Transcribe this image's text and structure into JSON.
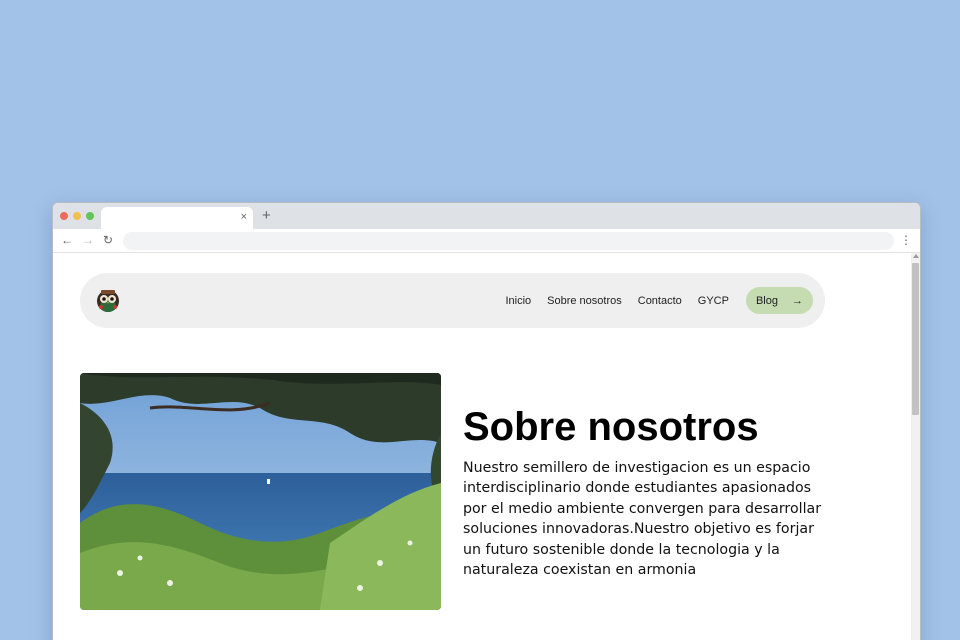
{
  "browser": {
    "tab_close": "×",
    "new_tab": "+",
    "back": "←",
    "forward": "→",
    "reload": "↻",
    "menu": "⋮"
  },
  "nav": {
    "links": [
      "Inicio",
      "Sobre nosotros",
      "Contacto",
      "GYCP"
    ],
    "cta_label": "Blog",
    "cta_arrow": "→"
  },
  "about": {
    "title": "Sobre nosotros",
    "text": "Nuestro semillero de investigacion es un espacio interdisciplinario donde estudiantes apasionados por el medio ambiente convergen para desarrollar soluciones innovadoras.Nuestro objetivo es forjar un futuro sostenible donde la tecnologia y la naturaleza coexistan en armonia"
  },
  "colors": {
    "background": "#a3c2e8",
    "nav_pill": "#efefef",
    "cta": "#c5dcb2"
  },
  "icons": {
    "logo": "owl-mascot-icon"
  }
}
